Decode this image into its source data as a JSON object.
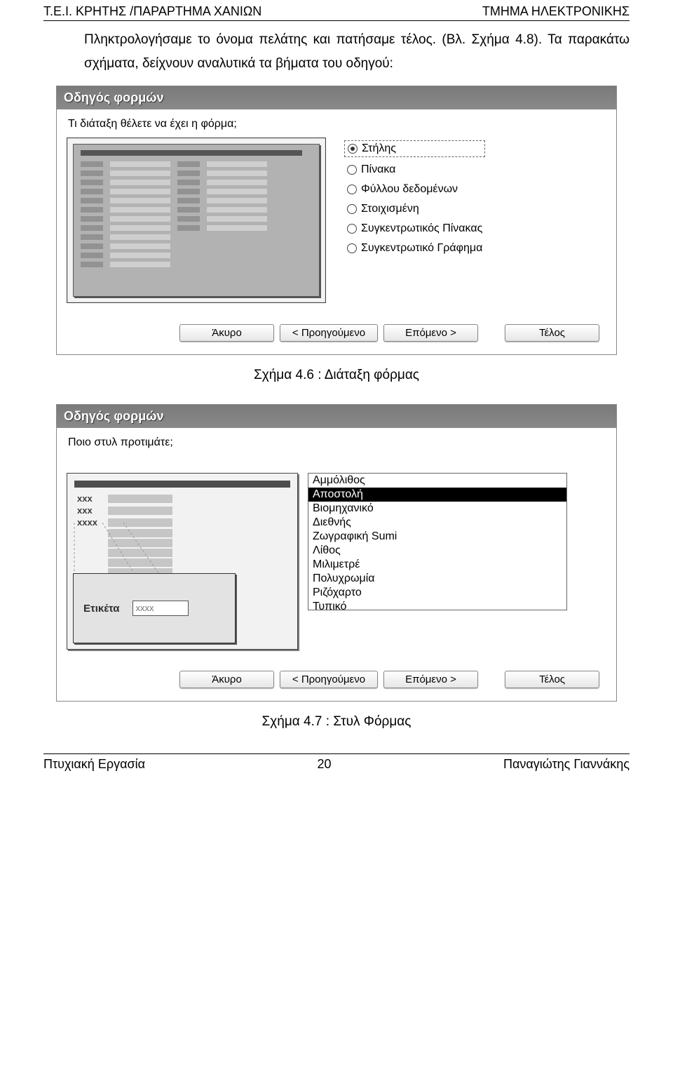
{
  "header": {
    "left": "T.E.I. ΚΡΗΤΗΣ /ΠΑΡΑΡΤΗΜΑ ΧΑΝΙΩΝ",
    "right": "ΤΜΗΜΑ ΗΛΕΚΤΡΟΝΙΚΗΣ"
  },
  "body_paragraph": "Πληκτρολογήσαμε το όνομα πελάτης και πατήσαμε τέλος. (Βλ. Σχήμα 4.8). Τα παρακάτω σχήματα, δείχνουν αναλυτικά τα βήματα του οδηγού:",
  "wizard1": {
    "title": "Οδηγός φορμών",
    "question": "Τι διάταξη θέλετε να έχει η φόρμα;",
    "options": [
      "Στήλης",
      "Πίνακα",
      "Φύλλου δεδομένων",
      "Στοιχισμένη",
      "Συγκεντρωτικός Πίνακας",
      "Συγκεντρωτικό Γράφημα"
    ],
    "selected_index": 0,
    "buttons": {
      "cancel": "Άκυρο",
      "back": "< Προηγούμενο",
      "next": "Επόμενο >",
      "finish": "Τέλος"
    }
  },
  "caption1": "Σχήμα 4.6 : Διάταξη φόρμας",
  "wizard2": {
    "title": "Οδηγός φορμών",
    "question": "Ποιο στυλ προτιμάτε;",
    "preview": {
      "row_labels": [
        "xxx",
        "xxx",
        "xxxx"
      ],
      "card_label": "Ετικέτα",
      "card_value": "xxxx"
    },
    "styles": [
      "Αμμόλιθος",
      "Αποστολή",
      "Βιομηχανικό",
      "Διεθνής",
      "Ζωγραφική Sumi",
      "Λίθος",
      "Μιλιμετρέ",
      "Πολυχρωμία",
      "Ριζόχαρτο",
      "Τυπικό"
    ],
    "selected_style_index": 1,
    "buttons": {
      "cancel": "Άκυρο",
      "back": "< Προηγούμενο",
      "next": "Επόμενο >",
      "finish": "Τέλος"
    }
  },
  "caption2": "Σχήμα 4.7 : Στυλ Φόρμας",
  "footer": {
    "left": "Πτυχιακή Εργασία",
    "center": "20",
    "right": "Παναγιώτης Γιαννάκης"
  }
}
